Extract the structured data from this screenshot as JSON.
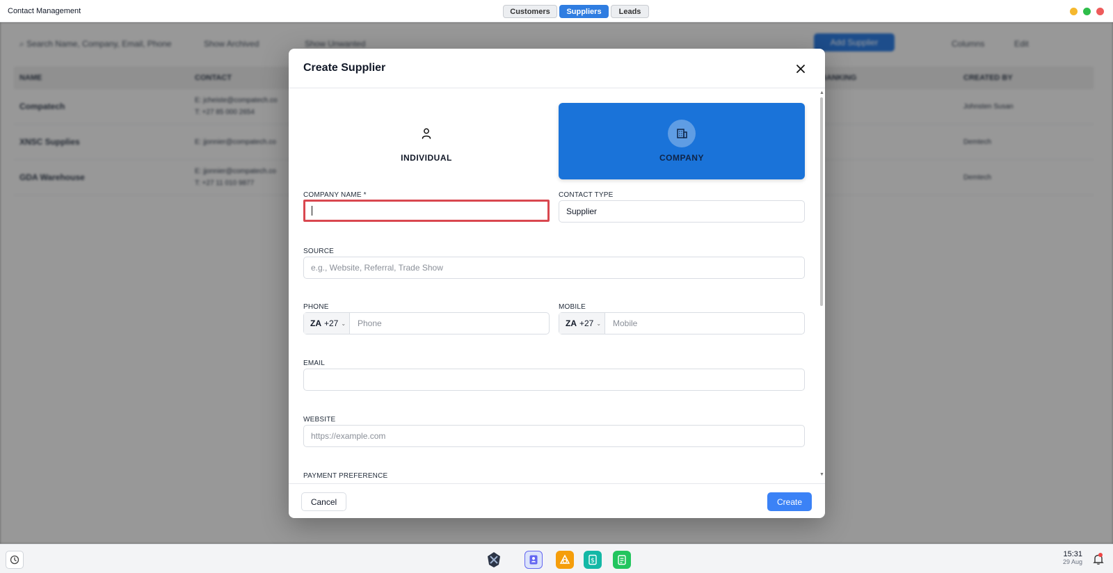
{
  "titlebar": {
    "app_title": "Contact Management",
    "tabs": [
      {
        "label": "Customers",
        "active": false
      },
      {
        "label": "Suppliers",
        "active": true
      },
      {
        "label": "Leads",
        "active": false
      }
    ],
    "window_button_colors": [
      "#f5b82e",
      "#2ebd4a",
      "#ee5b5b"
    ]
  },
  "background": {
    "search_placeholder": "Search Name, Company, Email, Phone",
    "chip_1": "Show Archived",
    "chip_2": "Show Unwanted",
    "add_button": "Add Supplier",
    "columns_label": "Columns",
    "edit_label": "Edit",
    "table_headers": [
      "NAME",
      "CONTACT",
      "BANKING",
      "CREATED BY"
    ],
    "rows": [
      {
        "name": "Compatech",
        "contact": [
          "E: jcheiste@compatech.co",
          "T: +27 85 000 2654"
        ],
        "created": "Johnsten Susan"
      },
      {
        "name": "XNSC Supplies",
        "contact": [
          "E: jjonnier@compatech.co"
        ],
        "created": "Demtech"
      },
      {
        "name": "GDA Warehouse",
        "contact": [
          "E: jjonnier@compatech.co",
          "T: +27 11 010 9877"
        ],
        "created": "Demtech"
      }
    ]
  },
  "modal": {
    "title": "Create Supplier",
    "type_individual": "INDIVIDUAL",
    "type_company": "COMPANY",
    "company_name_label": "COMPANY NAME *",
    "contact_type_label": "CONTACT TYPE",
    "contact_type_value": "Supplier",
    "source_label": "SOURCE",
    "source_placeholder": "e.g., Website, Referral, Trade Show",
    "phone_label": "PHONE",
    "phone_country_code": "ZA",
    "phone_country_dial": "+27",
    "phone_placeholder": "Phone",
    "mobile_label": "MOBILE",
    "mobile_country_code": "ZA",
    "mobile_country_dial": "+27",
    "mobile_placeholder": "Mobile",
    "email_label": "EMAIL",
    "website_label": "WEBSITE",
    "website_placeholder": "https://example.com",
    "payment_label": "PAYMENT PREFERENCE",
    "cancel_label": "Cancel",
    "create_label": "Create"
  },
  "taskbar": {
    "time": "15:31",
    "date": "29 Aug",
    "apps": [
      {
        "icon": "contacts-icon",
        "color": "#6366f1"
      },
      {
        "icon": "shapes-icon",
        "color": "#f59e0b"
      },
      {
        "icon": "dollar-doc-icon",
        "color": "#14b8a6"
      },
      {
        "icon": "checklist-icon",
        "color": "#22c55e"
      }
    ]
  }
}
